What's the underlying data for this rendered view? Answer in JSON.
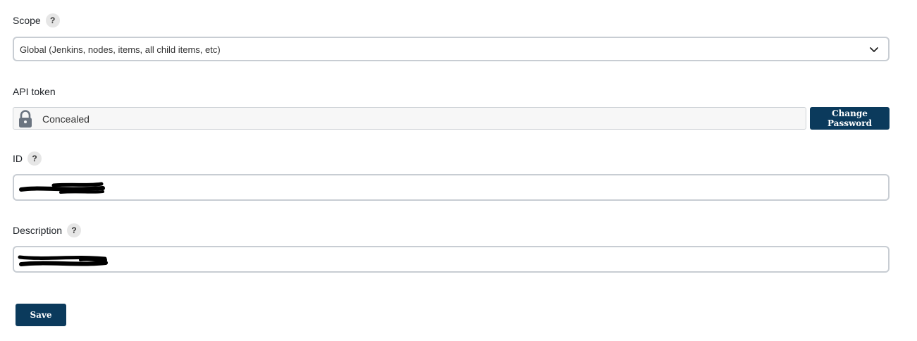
{
  "scope": {
    "label": "Scope",
    "help": "?",
    "selected": "Global (Jenkins, nodes, items, all child items, etc)"
  },
  "api_token": {
    "label": "API token",
    "value": "Concealed",
    "change_button": "Change Password"
  },
  "id_field": {
    "label": "ID",
    "help": "?"
  },
  "description_field": {
    "label": "Description",
    "help": "?"
  },
  "save_label": "Save",
  "colors": {
    "button": "#0b3a5c",
    "border": "#c8cdd3",
    "help_bg": "#e6e6e6"
  }
}
